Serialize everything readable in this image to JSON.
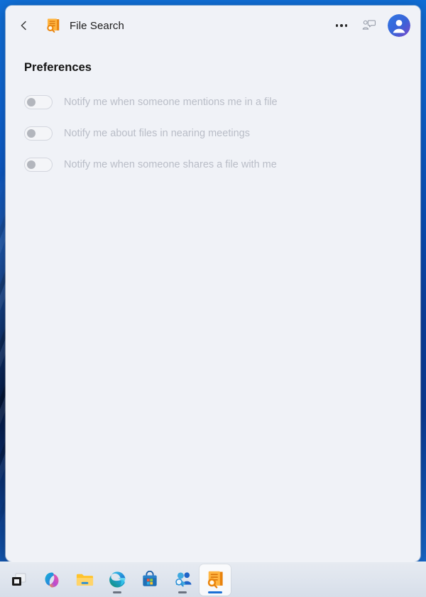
{
  "window": {
    "app_title": "File Search",
    "app_icon": "file-search-icon",
    "back_icon": "back-chevron-icon",
    "more_icon": "ellipsis-icon",
    "feedback_icon": "feedback-chat-icon",
    "avatar_icon": "user-avatar-icon",
    "accent_color": "#1b6fd4",
    "app_icon_color": "#f7a428",
    "avatar_gradient_from": "#2f6fe0",
    "avatar_gradient_to": "#7b44c9"
  },
  "content": {
    "page_title": "Preferences",
    "preferences": [
      {
        "label": "Notify me when someone mentions me in a file",
        "enabled": false
      },
      {
        "label": "Notify me about files in nearing meetings",
        "enabled": false
      },
      {
        "label": "Notify me when someone shares a file with me",
        "enabled": false
      }
    ]
  },
  "taskbar": {
    "items": [
      {
        "name": "task-view",
        "icon": "task-view-icon",
        "running": false,
        "active": false
      },
      {
        "name": "copilot",
        "icon": "copilot-icon",
        "running": false,
        "active": false
      },
      {
        "name": "file-explorer",
        "icon": "folder-icon",
        "running": false,
        "active": false
      },
      {
        "name": "microsoft-edge",
        "icon": "edge-icon",
        "running": true,
        "active": false
      },
      {
        "name": "microsoft-store",
        "icon": "store-icon",
        "running": false,
        "active": false
      },
      {
        "name": "search-people",
        "icon": "people-search-icon",
        "running": true,
        "active": false
      },
      {
        "name": "file-search-app",
        "icon": "file-search-icon",
        "running": true,
        "active": true
      }
    ]
  }
}
